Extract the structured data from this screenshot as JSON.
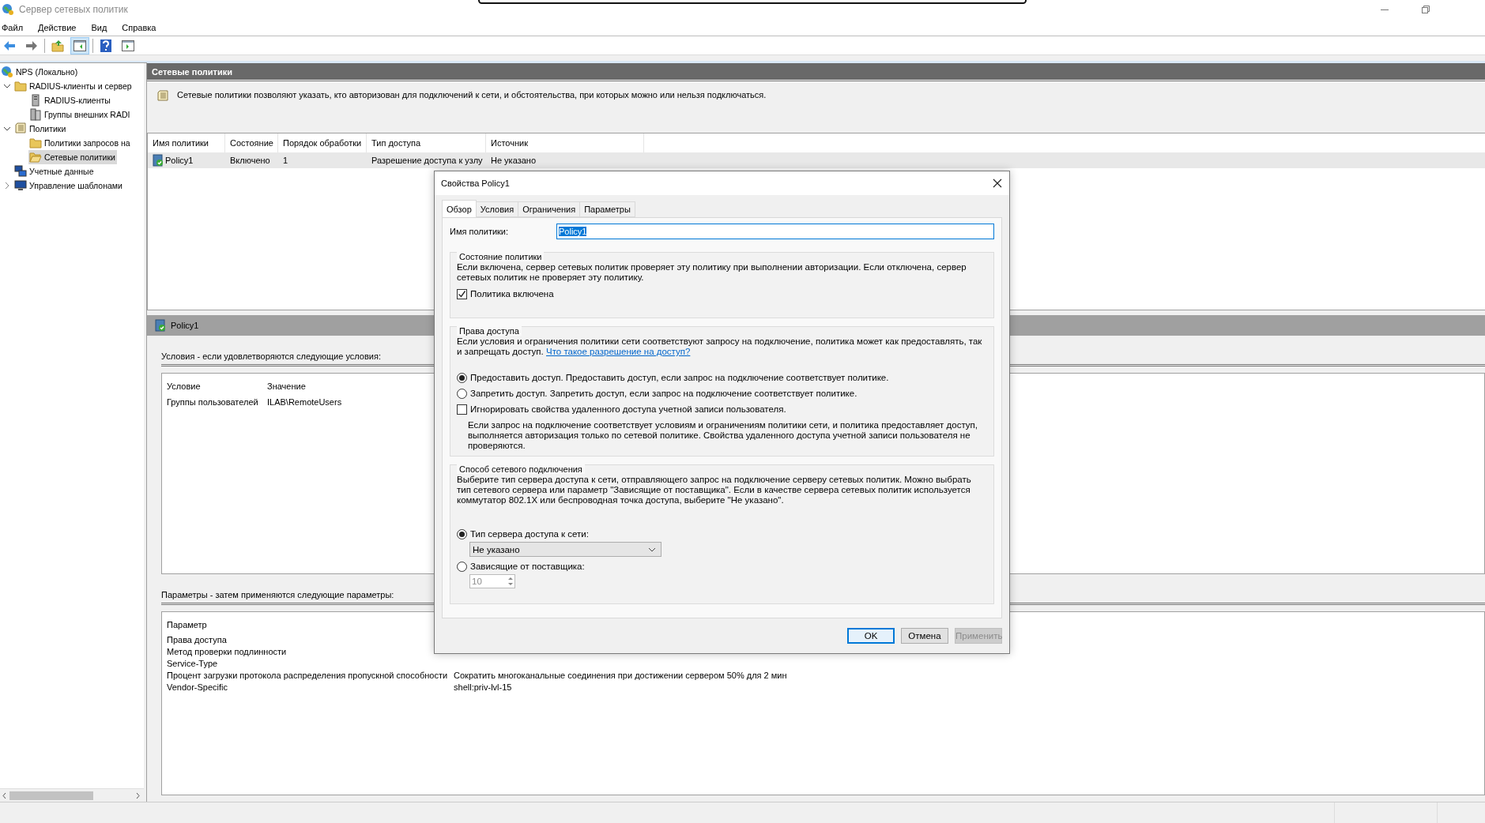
{
  "window": {
    "title": "Сервер сетевых политик"
  },
  "menu": [
    "Файл",
    "Действие",
    "Вид",
    "Справка"
  ],
  "tree": [
    {
      "label": "NPS (Локально)",
      "kind": "globe",
      "selected": false,
      "children": [
        {
          "label": "RADIUS-клиенты и сервер",
          "kind": "folder",
          "selected": false,
          "expanded": true,
          "children": [
            {
              "label": "RADIUS-клиенты",
              "kind": "server",
              "selected": false
            },
            {
              "label": "Группы внешних RADI",
              "kind": "servers",
              "selected": false
            }
          ]
        },
        {
          "label": "Политики",
          "kind": "scroll",
          "selected": false,
          "expanded": true,
          "children": [
            {
              "label": "Политики запросов на",
              "kind": "folder",
              "selected": false
            },
            {
              "label": "Сетевые политики",
              "kind": "folder-open",
              "selected": true
            }
          ]
        },
        {
          "label": "Учетные данные",
          "kind": "computers",
          "selected": false
        },
        {
          "label": "Управление шаблонами",
          "kind": "monitor",
          "selected": false,
          "expanded": false
        }
      ]
    }
  ],
  "pane": {
    "title": "Сетевые политики",
    "description": "Сетевые политики позволяют указать, кто авторизован для подключений к сети, и обстоятельства, при которых можно или нельзя подключаться.",
    "columns": [
      "Имя политики",
      "Состояние",
      "Порядок обработки",
      "Тип доступа",
      "Источник"
    ],
    "rows": [
      {
        "cells": [
          "Policy1",
          "Включено",
          "1",
          "Разрешение доступа к узлу",
          "Не указано"
        ],
        "selected": true
      }
    ]
  },
  "details": {
    "title": "Policy1",
    "conditions_label": "Условия - если удовлетворяются следующие условия:",
    "conditions_columns": [
      "Условие",
      "Значение"
    ],
    "conditions": [
      [
        "Группы пользователей",
        "ILAB\\RemoteUsers"
      ]
    ],
    "settings_label": "Параметры - затем применяются следующие параметры:",
    "settings_column": "Параметр",
    "settings": [
      {
        "name": "Права доступа"
      },
      {
        "name": "Метод проверки подлинности"
      },
      {
        "name": "Service-Type"
      },
      {
        "name": "Процент загрузки протокола распределения пропускной способности",
        "value": "Сократить многоканальные соединения при достижении сервером 50% для 2 мин"
      },
      {
        "name": "Vendor-Specific",
        "value": "shell:priv-lvl-15"
      }
    ]
  },
  "dialog": {
    "title": "Свойства Policy1",
    "tabs": [
      {
        "label": "Обзор",
        "selected": true
      },
      {
        "label": "Условия",
        "selected": false
      },
      {
        "label": "Ограничения",
        "selected": false
      },
      {
        "label": "Параметры",
        "selected": false
      }
    ],
    "name_label": "Имя политики:",
    "name_value": "Policy1",
    "name_text_selected": true,
    "state_group": {
      "title": "Состояние политики",
      "text": "Если включена, сервер сетевых политик проверяет эту политику при выполнении авторизации. Если отключена, сервер сетевых политик не проверяет эту политику.",
      "checkbox": {
        "label": "Политика включена",
        "checked": true
      }
    },
    "access_group": {
      "title": "Права доступа",
      "text": "Если условия и ограничения политики сети соответствуют запросу на подключение, политика может как предоставлять, так и запрещать доступ.",
      "link": "Что такое разрешение на доступ?",
      "options": [
        {
          "kind": "radio",
          "label": "Предоставить доступ. Предоставить доступ, если запрос на подключение соответствует политике.",
          "checked": true
        },
        {
          "kind": "radio",
          "label": "Запретить доступ. Запретить доступ, если запрос на подключение соответствует политике.",
          "checked": false
        },
        {
          "kind": "checkbox",
          "label": "Игнорировать свойства удаленного доступа учетной записи пользователя.",
          "checked": false
        }
      ],
      "note": "Если запрос на подключение соответствует условиям и ограничениям политики сети, и политика предоставляет доступ, выполняется авторизация только по сетевой политике. Свойства удаленного доступа учетной записи пользователя не проверяются."
    },
    "connection_group": {
      "title": "Способ сетевого подключения",
      "text": "Выберите тип сервера доступа к сети, отправляющего запрос на подключение серверу сетевых политик. Можно выбрать тип сетевого сервера или параметр \"Зависящие от поставщика\". Если в качестве сервера сетевых политик используется коммутатор 802.1X или беспроводная точка доступа, выберите \"Не указано\".",
      "server_type": {
        "label": "Тип сервера доступа к сети:",
        "checked": true,
        "value": "Не указано"
      },
      "vendor": {
        "label": "Зависящие от поставщика:",
        "checked": false,
        "value": "10",
        "disabled": true
      }
    },
    "buttons": [
      {
        "label": "OK",
        "default": true,
        "disabled": false
      },
      {
        "label": "Отмена",
        "default": false,
        "disabled": false
      },
      {
        "label": "Применить",
        "default": false,
        "disabled": true
      }
    ]
  }
}
